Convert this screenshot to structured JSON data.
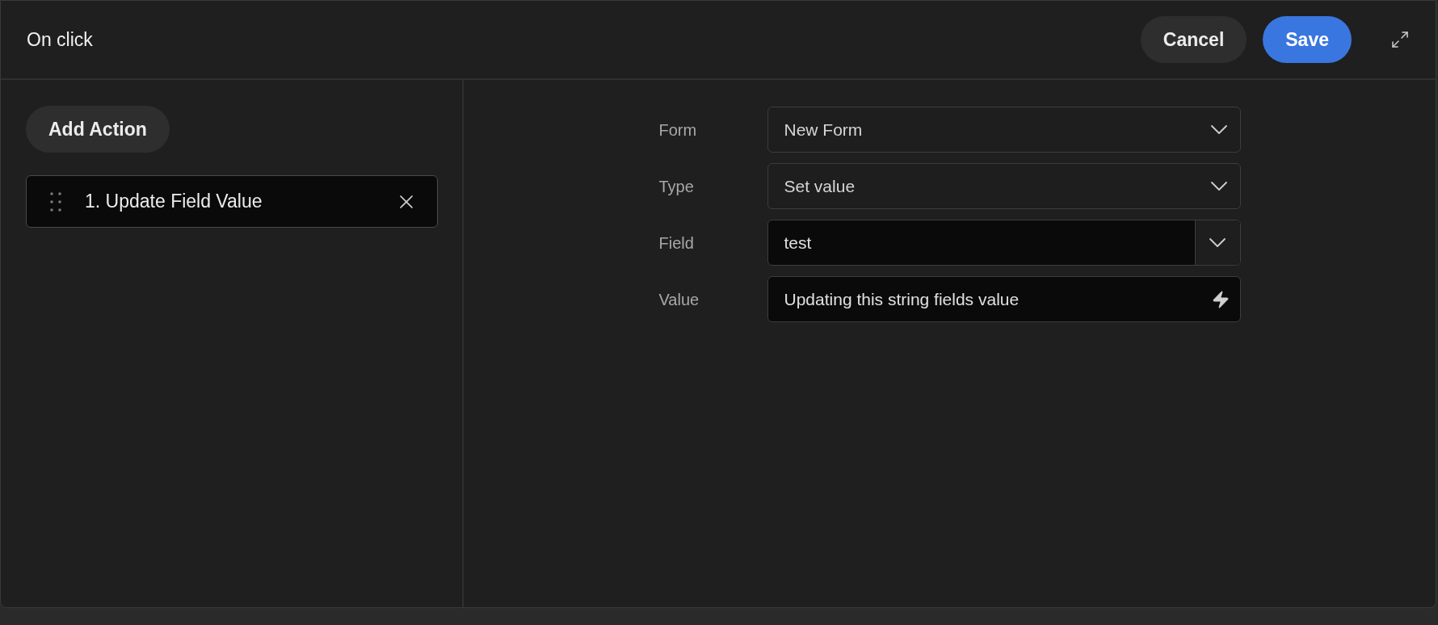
{
  "dialog": {
    "title": "On click",
    "buttons": [
      {
        "label": "Cancel",
        "kind": "secondary"
      },
      {
        "label": "Save",
        "kind": "primary"
      }
    ]
  },
  "sidebar": {
    "add_button": "Add Action",
    "actions": [
      {
        "label": "1. Update Field Value"
      }
    ]
  },
  "form": [
    {
      "label": "Form",
      "kind": "select",
      "value": "New Form"
    },
    {
      "label": "Type",
      "kind": "select",
      "value": "Set value"
    },
    {
      "label": "Field",
      "kind": "combo",
      "value": "test"
    },
    {
      "label": "Value",
      "kind": "dynamic",
      "value": "Updating this string fields value"
    }
  ]
}
